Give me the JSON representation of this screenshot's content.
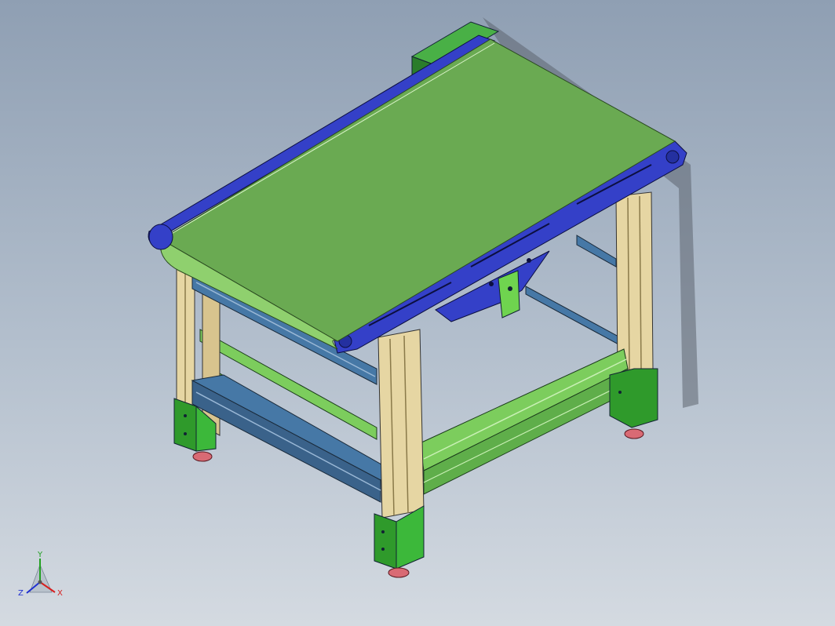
{
  "viewport": {
    "background_top": "#8f9fb3",
    "background_bottom": "#d4dae1"
  },
  "model": {
    "belt_color": "#6aaa52",
    "frame_color": "#3440c8",
    "leg_color": "#e6d6a3",
    "foot_color": "#2f9a2b",
    "pad_color": "#d96a74",
    "rail_blue_color": "#4678a6",
    "rail_green_color": "#7ccd5d"
  },
  "triad": {
    "x_label": "X",
    "y_label": "Y",
    "z_label": "Z",
    "x_color": "#d62020",
    "y_color": "#22a022",
    "z_color": "#2030d0"
  }
}
